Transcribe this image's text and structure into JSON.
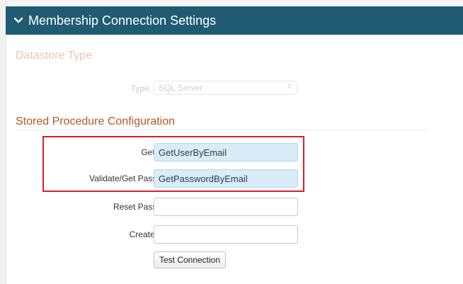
{
  "panel": {
    "title": "Membership Connection Settings",
    "header_color": "#1f5c73"
  },
  "datastore": {
    "heading": "Datastore Type",
    "type_label": "Type:",
    "type_value": "SQL Server"
  },
  "stored_procedures": {
    "heading": "Stored Procedure Configuration",
    "heading_color": "#b25826",
    "get_user_label": "Get User SP:",
    "get_user_value": "GetUserByEmail",
    "validate_password_label": "Validate/Get Password SP:",
    "validate_password_value": "GetPasswordByEmail",
    "reset_password_label": "Reset Password SP:",
    "reset_password_value": "",
    "create_user_label": "Create User SP:",
    "create_user_value": ""
  },
  "actions": {
    "test_connection_label": "Test Connection"
  },
  "icons": {
    "collapse": "chevron-down-icon",
    "select_arrow": "select-arrow-icon"
  },
  "colors": {
    "highlight_box": "#d8202a",
    "filled_input_bg": "#d9ecf7"
  }
}
